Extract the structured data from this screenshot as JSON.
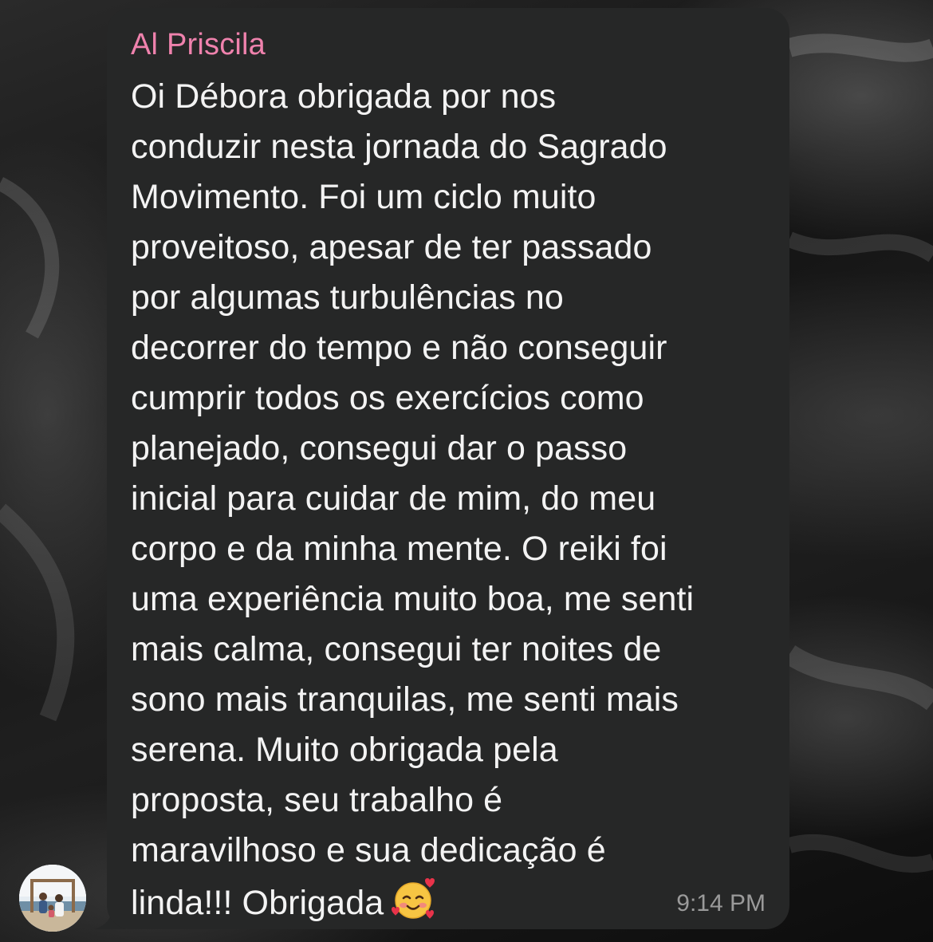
{
  "chat": {
    "sender_name": "Al Priscila",
    "message_lines": [
      "Oi Débora obrigada por nos",
      "conduzir nesta jornada do Sagrado",
      "Movimento. Foi um ciclo muito",
      "proveitoso, apesar de ter passado",
      "por algumas turbulências no",
      "decorrer do tempo e não conseguir",
      "cumprir todos os exercícios como",
      "planejado, consegui dar o passo",
      "inicial para cuidar de mim, do meu",
      "corpo e da minha mente. O reiki foi",
      "uma experiência muito boa, me senti",
      "mais calma, consegui ter noites de",
      "sono mais tranquilas, me senti mais",
      "serena. Muito obrigada pela",
      "proposta, seu trabalho é",
      "maravilhoso e sua dedicação é",
      "linda!!! Obrigada"
    ],
    "emoji": "smiling-face-with-hearts",
    "timestamp": "9:14 PM"
  },
  "colors": {
    "bubble_background": "#262727",
    "sender_name": "#ef82ad",
    "message_text": "#f3f3f3",
    "timestamp": "#9a9a9a"
  },
  "icons": {
    "avatar": "avatar-photo",
    "emoji": "smiling-face-with-hearts-icon"
  }
}
